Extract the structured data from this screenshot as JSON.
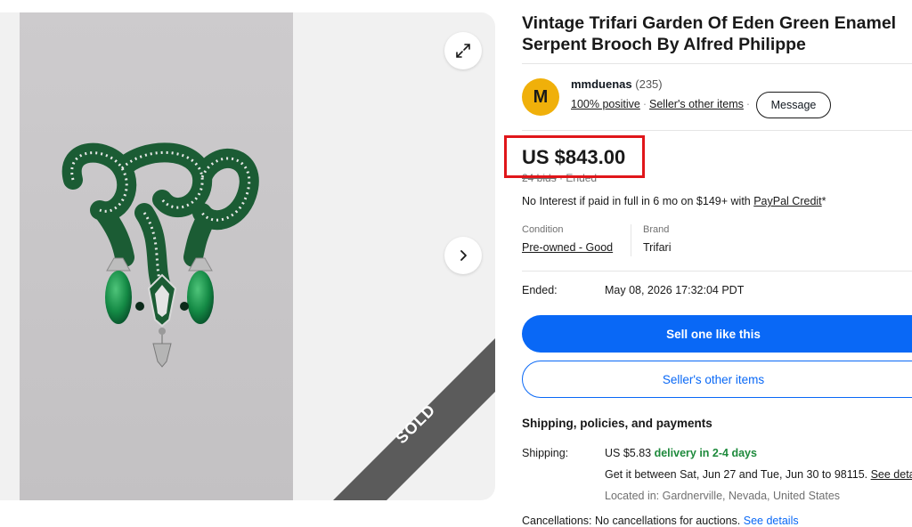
{
  "listing": {
    "title": "Vintage Trifari Garden Of Eden Green Enamel Serpent Brooch By Alfred Philippe",
    "sold_badge": "SOLD"
  },
  "seller": {
    "avatar_letter": "M",
    "name": "mmduenas",
    "feedback_count": "(235)",
    "positive": "100% positive",
    "other_items_link": "Seller's other items",
    "message_button": "Message"
  },
  "pricing": {
    "price": "US $843.00",
    "bids": "24 bids",
    "status": "Ended",
    "paypal_text": "No Interest if paid in full in 6 mo on $149+ with ",
    "paypal_link": "PayPal Credit",
    "paypal_suffix": "*"
  },
  "details": {
    "condition_label": "Condition",
    "condition_value": "Pre-owned - Good",
    "brand_label": "Brand",
    "brand_value": "Trifari",
    "ended_label": "Ended:",
    "ended_value": "May 08, 2026 17:32:04 PDT"
  },
  "actions": {
    "primary": "Sell one like this",
    "secondary": "Seller's other items"
  },
  "shipping": {
    "heading": "Shipping, policies, and payments",
    "label": "Shipping:",
    "cost": "US $5.83 ",
    "delivery": "delivery in 2-4 days",
    "estimate_text": "Get it between Sat, Jun 27 and Tue, Jun 30 to 98115. ",
    "estimate_link": "See deta",
    "location": "Located in: Gardnerville, Nevada, United States",
    "cancellations_label": "Cancellations:",
    "cancellations_text": "No cancellations for auctions. ",
    "cancellations_link": "See details"
  },
  "colors": {
    "accent": "#0968f6",
    "avatar": "#f0b00a",
    "highlight_box": "#e0161a",
    "delivery_green": "#1e8a3c",
    "enamel_green": "#1f6b3a"
  }
}
